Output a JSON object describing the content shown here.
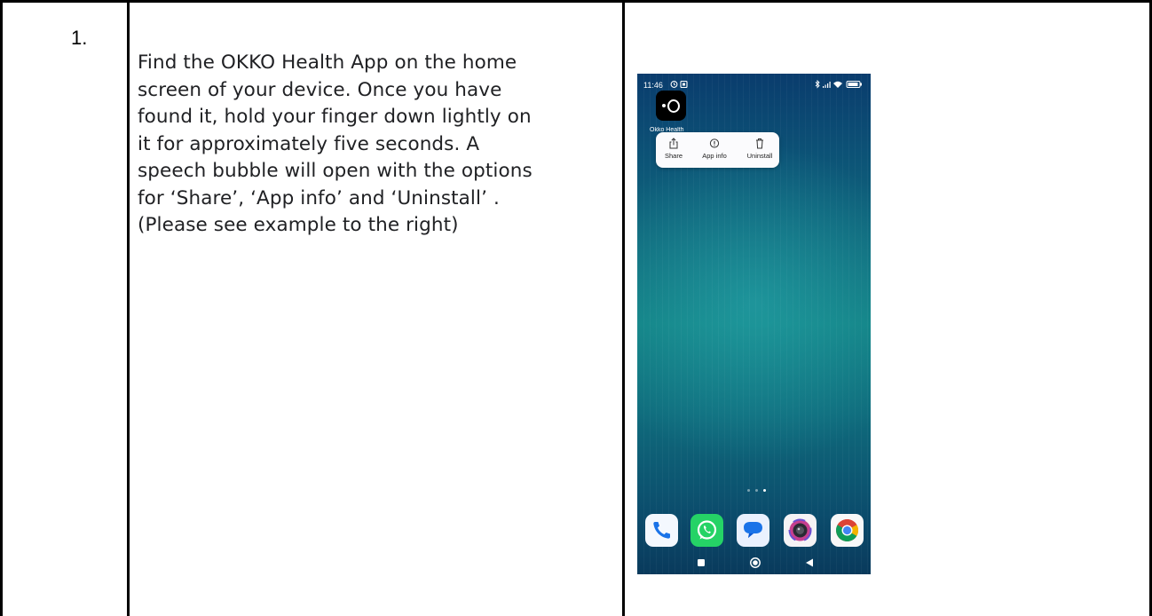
{
  "step": {
    "number": "1."
  },
  "instruction": {
    "lines": [
      "Find the OKKO Health App on the home",
      "screen of your device. Once you have",
      "found it, hold your finger down lightly on",
      "it for approximately five seconds. A",
      "speech bubble will open with the options",
      "for ‘Share’, ‘App info’ and ‘Uninstall’ .",
      "(Please see example to the right)"
    ]
  },
  "phone": {
    "status_time": "11:46",
    "app": {
      "label": "Okko Health"
    },
    "popup": {
      "share_label": "Share",
      "app_info_label": "App info",
      "uninstall_label": "Uninstall"
    },
    "dock_apps": [
      "phone-app",
      "whatsapp-app",
      "messages-app",
      "camera-app",
      "chrome-app"
    ],
    "colors": {
      "wallpaper_top": "#0a3c6d",
      "wallpaper_mid": "#128083",
      "phone_blue": "#1a73e8",
      "whatsapp_green": "#25d366",
      "messages_blue": "#1a73e8"
    }
  }
}
